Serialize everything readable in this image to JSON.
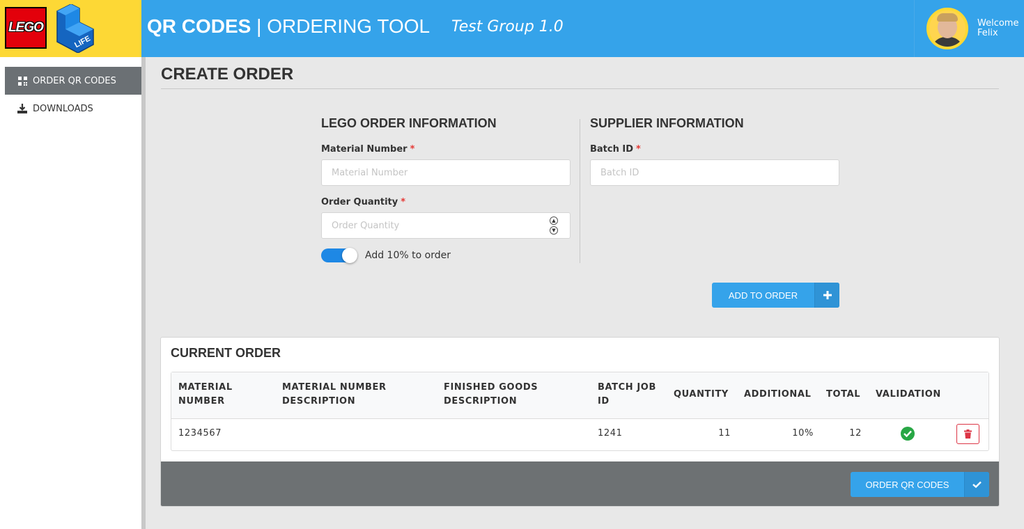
{
  "header": {
    "logo_text": "LEGO",
    "life_text": "LIFE",
    "title_bold": "QR CODES",
    "title_rest": " | ORDERING TOOL",
    "subtitle": "Test Group 1.0",
    "welcome": "Welcome",
    "user_name": "Felix",
    "brand_yellow": "#fdd835",
    "brand_blue": "#35a3ea"
  },
  "sidebar": {
    "items": [
      {
        "label": "ORDER QR CODES",
        "icon": "qr-grid-icon",
        "active": true
      },
      {
        "label": "DOWNLOADS",
        "icon": "download-icon",
        "active": false
      }
    ]
  },
  "page": {
    "title": "CREATE ORDER"
  },
  "lego_info": {
    "heading": "LEGO ORDER INFORMATION",
    "material_label": "Material Number",
    "material_placeholder": "Material Number",
    "material_value": "",
    "quantity_label": "Order Quantity",
    "quantity_placeholder": "Order Quantity",
    "quantity_value": "",
    "required_mark": "*",
    "toggle_label": "Add 10% to order",
    "toggle_on": true
  },
  "supplier_info": {
    "heading": "SUPPLIER INFORMATION",
    "batch_label": "Batch ID",
    "batch_placeholder": "Batch ID",
    "batch_value": ""
  },
  "add_button": {
    "label": "ADD TO ORDER",
    "icon": "plus-icon"
  },
  "current_order": {
    "title": "CURRENT ORDER",
    "columns": [
      "MATERIAL NUMBER",
      "MATERIAL NUMBER DESCRIPTION",
      "FINISHED GOODS DESCRIPTION",
      "BATCH JOB ID",
      "QUANTITY",
      "ADDITIONAL",
      "TOTAL",
      "VALIDATION"
    ],
    "rows": [
      {
        "material_number": "1234567",
        "material_description": "",
        "finished_goods_description": "",
        "batch_job_id": "1241",
        "quantity": "11",
        "additional": "10%",
        "total": "12",
        "validation": "valid"
      }
    ],
    "order_button": {
      "label": "ORDER QR CODES",
      "icon": "check-icon"
    }
  }
}
